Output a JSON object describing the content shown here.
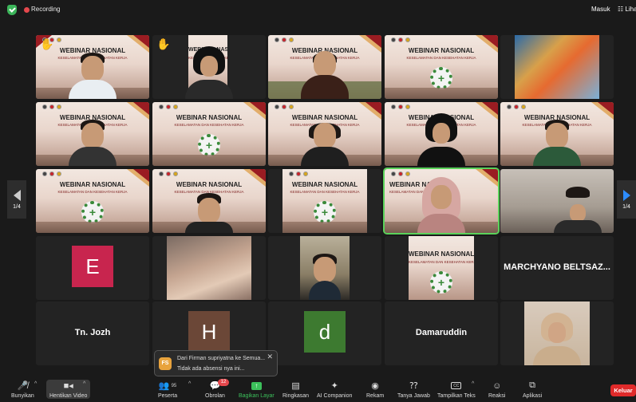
{
  "topbar": {
    "recording_label": "Recording",
    "sign_in_label": "Masuk",
    "view_label": "☷ Lihat"
  },
  "colors": {
    "recording": "#e5484d",
    "active_green": "#3cc05b",
    "leave_red": "#e02a2a",
    "avatar_e": "#c8254e",
    "avatar_h": "#6b4737",
    "avatar_d": "#3d7a30"
  },
  "banner": {
    "title": "WEBINAR NASIONAL",
    "subtitle": "KESELAMATAN DAN KESEHATAN KERJA"
  },
  "participants": {
    "avatar_e": "E",
    "avatar_h": "H",
    "avatar_d": "d",
    "name_marchyano": "MARCHYANO BELTSAZ...",
    "name_jozh": "Tn. Jozh",
    "name_damaruddin": "Damaruddin"
  },
  "pager": {
    "left": "1/4",
    "right": "1/4"
  },
  "notification": {
    "avatar_initials": "FS",
    "line1": "Dari Firman supriyatna ke Semua...",
    "line2": "Tidak ada absensi nya ini..."
  },
  "toolbar": {
    "mute": "Bunyikan",
    "stop_video": "Hentikan Video",
    "participants": "Peserta",
    "participants_count": "95",
    "chat": "Obrolan",
    "chat_badge": "12",
    "share": "Bagikan Layar",
    "summary": "Ringkasan",
    "ai": "AI Companion",
    "record": "Rekam",
    "qa": "Tanya Jawab",
    "captions": "Tampilkan Teks",
    "cc": "CC",
    "reactions": "Reaksi",
    "apps": "Aplikasi",
    "leave": "Keluar"
  }
}
